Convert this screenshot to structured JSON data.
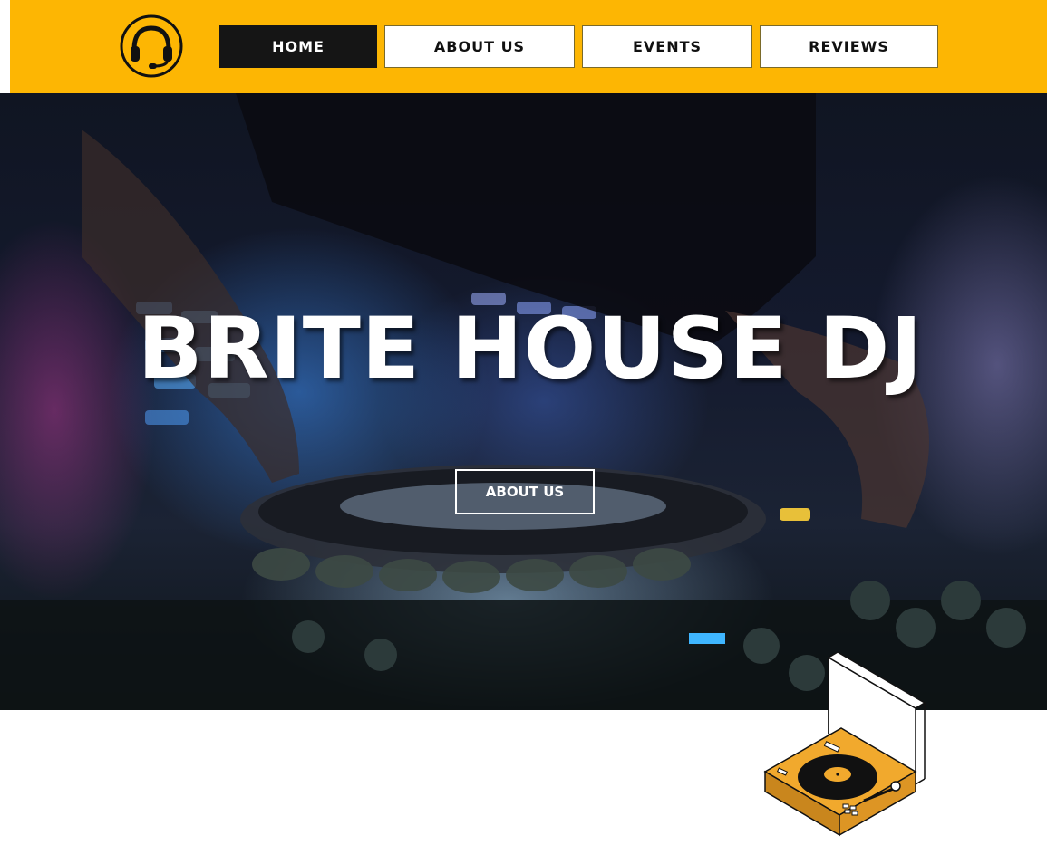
{
  "header": {
    "logo_icon": "headset-icon",
    "nav": [
      {
        "label": "HOME",
        "active": true
      },
      {
        "label": "ABOUT US",
        "active": false
      },
      {
        "label": "EVENTS",
        "active": false
      },
      {
        "label": "REVIEWS",
        "active": false
      }
    ]
  },
  "hero": {
    "title": "BRITE HOUSE DJ",
    "button_label": "ABOUT US",
    "background_image": "dj-mixing-photo"
  },
  "illustration": {
    "icon": "turntable-icon"
  },
  "colors": {
    "brand_yellow": "#FDB603",
    "nav_active_bg": "#151515",
    "turntable_orange": "#F1A92D"
  }
}
